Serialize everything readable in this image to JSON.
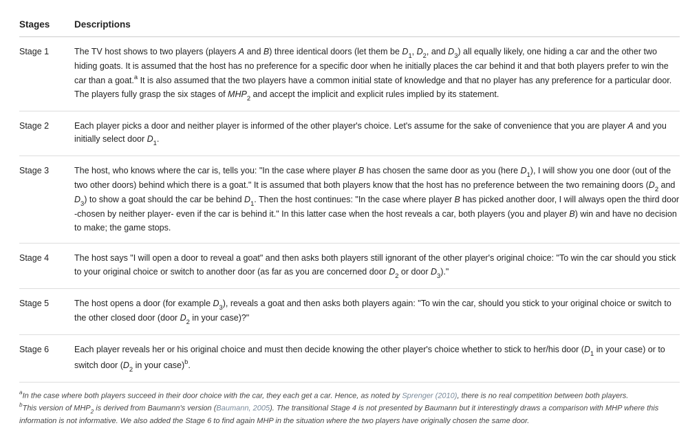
{
  "headers": {
    "stages": "Stages",
    "descriptions": "Descriptions"
  },
  "rows": [
    {
      "label": "Stage 1",
      "text_parts": [
        "The TV host shows to two players (players ",
        {
          "i": "A"
        },
        " and ",
        {
          "i": "B"
        },
        ") three identical doors (let them be ",
        {
          "d": "D",
          "s": "1"
        },
        ", ",
        {
          "d": "D",
          "s": "2"
        },
        ", and ",
        {
          "d": "D",
          "s": "3"
        },
        ") all equally likely, one hiding a car and the other two hiding goats. It is assumed that the host has no preference for a specific door when he initially places the car behind it and that both players prefer to win the car than a goat.",
        {
          "sup": "a"
        },
        " It is also assumed that the two players have a common initial state of knowledge and that no player has any preference for a particular door. The players fully grasp the six stages of ",
        {
          "i": "MHP"
        },
        {
          "sub": "2"
        },
        " and accept the implicit and explicit rules implied by its statement."
      ]
    },
    {
      "label": "Stage 2",
      "text_parts": [
        "Each player picks a door and neither player is informed of the other player's choice. Let's assume for the sake of convenience that you are player ",
        {
          "i": "A"
        },
        " and you initially select door ",
        {
          "d": "D",
          "s": "1"
        },
        "."
      ]
    },
    {
      "label": "Stage 3",
      "text_parts": [
        "The host, who knows where the car is, tells you: \"In the case where player ",
        {
          "i": "B"
        },
        " has chosen the same door as you (here ",
        {
          "d": "D",
          "s": "1"
        },
        "), I will show you one door (out of the two other doors) behind which there is a goat.\" It is assumed that both players know that the host has no preference between the two remaining doors (",
        {
          "d": "D",
          "s": "2"
        },
        " and ",
        {
          "d": "D",
          "s": "3"
        },
        ") to show a goat should the car be behind ",
        {
          "d": "D",
          "s": "1"
        },
        ". Then the host continues: \"In the case where player ",
        {
          "i": "B"
        },
        " has picked another door, I will always open the third door -chosen by neither player- even if the car is behind it.\" In this latter case when the host reveals a car, both players (you and player ",
        {
          "i": "B"
        },
        ") win and have no decision to make; the game stops."
      ]
    },
    {
      "label": "Stage 4",
      "text_parts": [
        "The host says \"I will open a door to reveal a goat\" and then asks both players still ignorant of the other player's original choice: \"To win the car should you stick to your original choice or switch to another door (as far as you are concerned door ",
        {
          "d": "D",
          "s": "2"
        },
        " or door ",
        {
          "d": "D",
          "s": "3"
        },
        ").\""
      ]
    },
    {
      "label": "Stage 5",
      "text_parts": [
        "The host opens a door (for example ",
        {
          "d": "D",
          "s": "3"
        },
        "), reveals a goat and then asks both players again: \"To win the car, should you stick to your original choice or switch to the other closed door (door ",
        {
          "d": "D",
          "s": "2"
        },
        " in your case)?\""
      ]
    },
    {
      "label": "Stage 6",
      "text_parts": [
        "Each player reveals her or his original choice and must then decide knowing the other player's choice whether to stick to her/his door (",
        {
          "d": "D",
          "s": "1"
        },
        " in your case) or to switch door (",
        {
          "d": "D",
          "s": "2"
        },
        " in your case)",
        {
          "sup": "b"
        },
        "."
      ]
    }
  ],
  "footnotes": [
    {
      "mark": "a",
      "parts": [
        "In the case where both players succeed in their door choice with the car, they each get a car. Hence, as noted by ",
        {
          "ref": "Sprenger (2010)"
        },
        ", there is no real competition between both players."
      ]
    },
    {
      "mark": "b",
      "parts": [
        "This version of MHP",
        {
          "sub": "2"
        },
        " is derived from Baumann's version (",
        {
          "ref": "Baumann, 2005"
        },
        "). The transitional Stage 4 is not presented by Baumann but it interestingly draws a comparison with MHP where this information is not informative. We also added the Stage 6 to find again MHP in the situation where the two players have originally chosen the same door."
      ]
    }
  ]
}
